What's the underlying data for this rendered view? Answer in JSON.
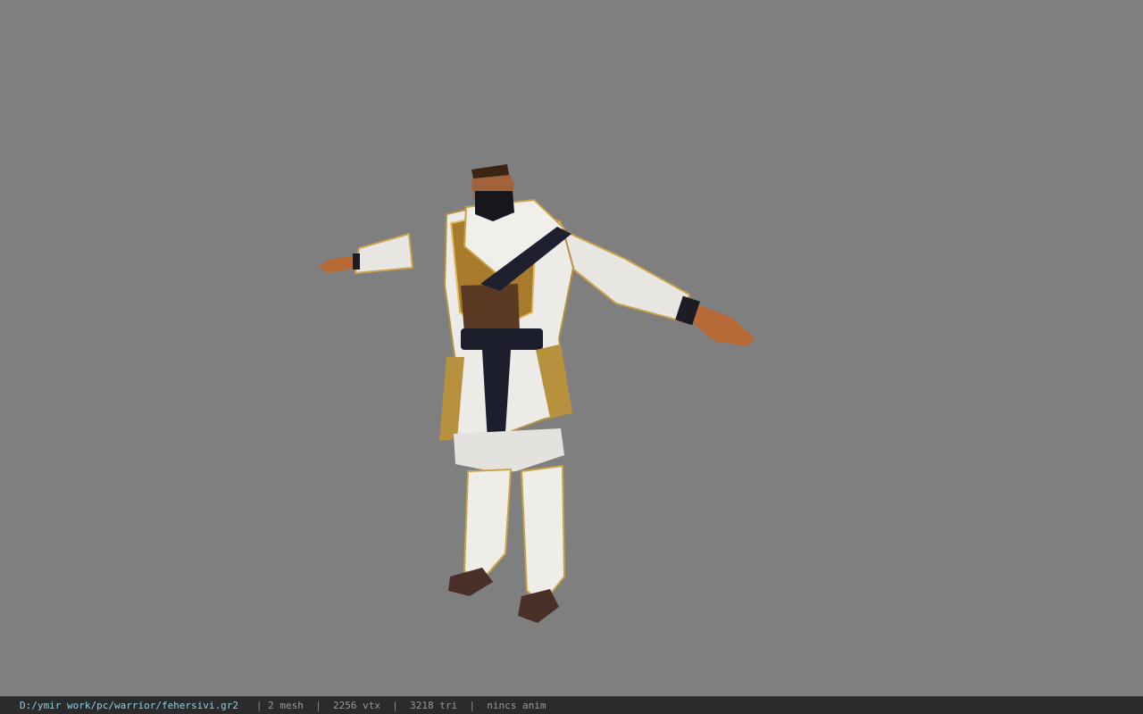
{
  "viewport": {
    "background_color": "#7f7f7f",
    "model_subject": "warrior-character-t-pose"
  },
  "statusbar": {
    "file_path": "D:/ymir work/pc/warrior/fehersivi.gr2",
    "separator": "|",
    "mesh_count": "2 mesh",
    "vertex_count": "2256 vtx",
    "triangle_count": "3218 tri",
    "anim_status": "nincs anim",
    "path_color": "#8fd0e6",
    "text_color": "#9a9a9a",
    "background_color": "#2b2b2b"
  }
}
